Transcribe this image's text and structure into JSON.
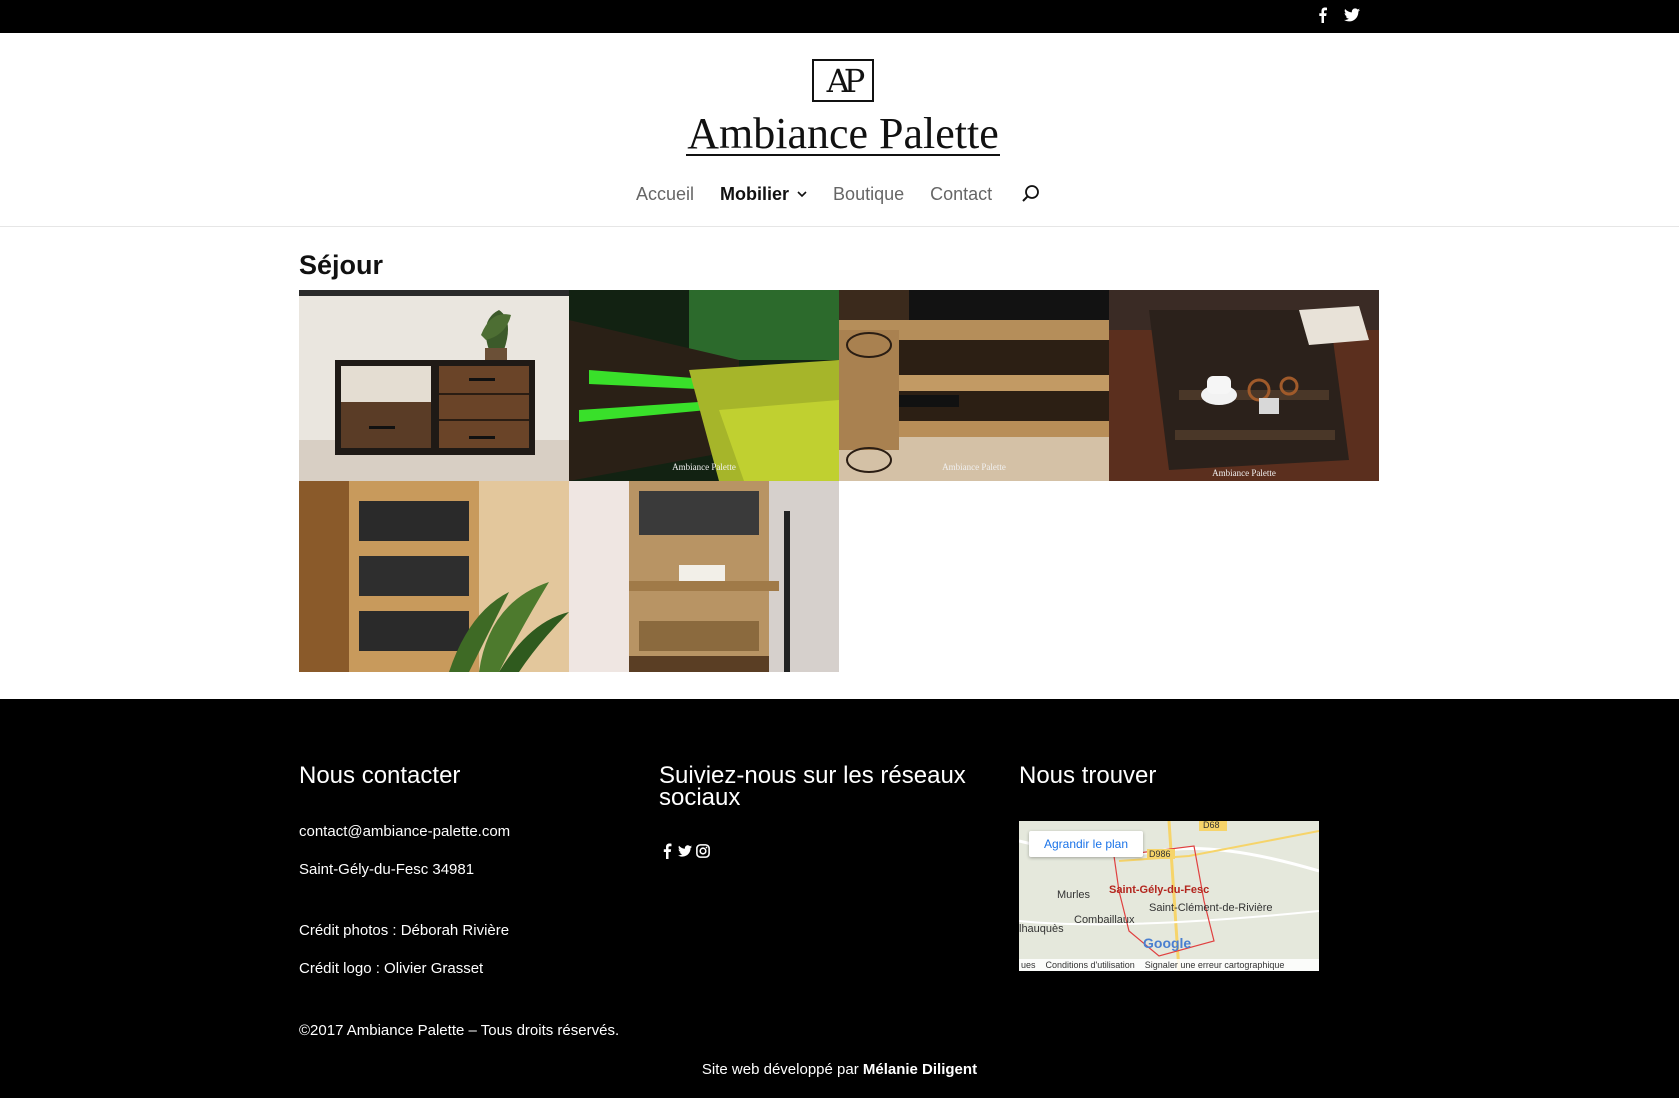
{
  "topbar": {
    "social": [
      {
        "icon": "facebook-icon",
        "name": "top-facebook-link"
      },
      {
        "icon": "twitter-icon",
        "name": "top-twitter-link"
      }
    ]
  },
  "logo": {
    "monogram": "AP",
    "text": "Ambiance Palette"
  },
  "nav": {
    "items": [
      {
        "label": "Accueil"
      },
      {
        "label": "Mobilier",
        "active": true,
        "has_submenu": true
      },
      {
        "label": "Boutique"
      },
      {
        "label": "Contact"
      }
    ],
    "search_icon": "search-icon"
  },
  "main": {
    "title": "Séjour",
    "gallery": [
      {
        "desc": "dresser",
        "watermark": ""
      },
      {
        "desc": "green-lit bench",
        "watermark": "Ambiance Palette"
      },
      {
        "desc": "pallet tv stand",
        "watermark": "Ambiance Palette"
      },
      {
        "desc": "dark shelf",
        "watermark": "Ambiance Palette"
      },
      {
        "desc": "dvd shelf",
        "watermark": ""
      },
      {
        "desc": "shelf with desk",
        "watermark": ""
      }
    ]
  },
  "footer": {
    "contact": {
      "title": "Nous contacter",
      "email": "contact@ambiance-palette.com",
      "address": "Saint-Gély-du-Fesc 34981",
      "photo_credit": "Crédit photos : Déborah Rivière",
      "logo_credit": "Crédit logo : Olivier Grasset",
      "copyright": "©2017 Ambiance Palette – Tous droits réservés."
    },
    "social": {
      "title": "Suiviez-nous sur les réseaux sociaux"
    },
    "map": {
      "title": "Nous trouver",
      "enlarge_button": "Agrandir le plan",
      "labels": {
        "murles": "Murles",
        "saint_gely": "Saint-Gély-du-Fesc",
        "saint_clement": "Saint-Clément-de-Rivière",
        "combaillaux": "Combaillaux",
        "lhauques": "lhauquès",
        "d68": "D68",
        "d986": "D986",
        "google": "Google"
      },
      "footer_left": "ues",
      "terms": "Conditions d'utilisation",
      "report": "Signaler une erreur cartographique"
    },
    "credit_prefix": "Site web développé par",
    "credit_name": "Mélanie Diligent"
  }
}
